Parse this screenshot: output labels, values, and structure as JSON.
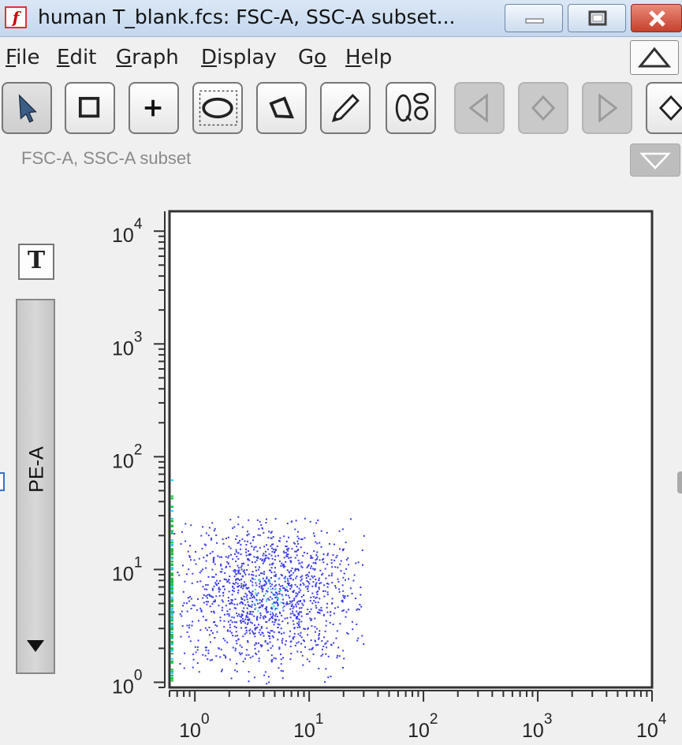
{
  "window": {
    "title": "human T_blank.fcs: FSC-A, SSC-A subset...",
    "app_icon": "flowjo-app-icon",
    "controls": [
      "minimize-icon",
      "restore-icon",
      "close-icon"
    ]
  },
  "menu": {
    "items": [
      {
        "label": "File",
        "mnemonic": "F",
        "rest": "ile"
      },
      {
        "label": "Edit",
        "mnemonic": "E",
        "rest": "dit"
      },
      {
        "label": "Graph",
        "mnemonic": "G",
        "rest": "raph"
      },
      {
        "label": "Display",
        "mnemonic": "D",
        "rest": "isplay"
      },
      {
        "label": "Go",
        "mnemonic": "o",
        "pre": "G"
      },
      {
        "label": "Help",
        "mnemonic": "H",
        "rest": "elp"
      }
    ],
    "collapse_icon": "triangle-up-icon"
  },
  "toolbar": {
    "tools": [
      "pointer-icon",
      "rectangle-gate-icon",
      "quadrant-crosshair-icon",
      "ellipse-gate-icon",
      "polygon-gate-icon",
      "freehand-pencil-icon",
      "quad-gate-icon",
      "previous-arrow-icon",
      "diamond-icon",
      "next-arrow-icon",
      "diamond-icon"
    ]
  },
  "subset_label": "FSC-A, SSC-A subset",
  "expand_icon": "triangle-down-icon",
  "text_tool_label": "T",
  "y_param": {
    "label": "PE-A",
    "dropdown_icon": "triangle-down-icon"
  },
  "chart_data": {
    "type": "scatter",
    "x_scale": "log",
    "y_scale": "log",
    "xlim": [
      0.6,
      10000
    ],
    "ylim": [
      0.9,
      15000
    ],
    "x_ticks": [
      {
        "base": "10",
        "exp": "0"
      },
      {
        "base": "10",
        "exp": "1"
      },
      {
        "base": "10",
        "exp": "2"
      },
      {
        "base": "10",
        "exp": "3"
      },
      {
        "base": "10",
        "exp": "4"
      }
    ],
    "y_ticks": [
      {
        "base": "10",
        "exp": "0"
      },
      {
        "base": "10",
        "exp": "1"
      },
      {
        "base": "10",
        "exp": "2"
      },
      {
        "base": "10",
        "exp": "3"
      },
      {
        "base": "10",
        "exp": "4"
      }
    ],
    "ylabel": "PE-A",
    "point_color": "#3a3ae8",
    "dense_color": "#38c8e8",
    "axis_pile_color": "#22bb44",
    "cluster": {
      "x_center": 4.5,
      "y_center": 6.0,
      "x_spread_decades": 0.38,
      "y_spread_decades": 0.32,
      "count": 1400
    }
  }
}
